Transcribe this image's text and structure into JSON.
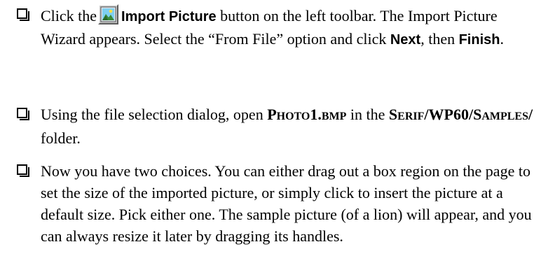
{
  "steps": [
    {
      "p1": "Click the",
      "button_label": "Import Picture",
      "p2": " button on the left toolbar. The Import Picture Wizard appears. Select the “From File” option and click ",
      "next_label": "Next",
      "p3": ", then ",
      "finish_label": "Finish",
      "p4": "."
    },
    {
      "p1": "Using the file selection dialog, open ",
      "file_first": "P",
      "file_rest": "HOTO",
      "file_num": "1.",
      "file_ext": "BMP",
      "p2": " in the ",
      "folder_s": "S",
      "folder_rest": "ERIF",
      "folder_mid": "/WP60/",
      "folder_s2": "S",
      "folder_rest2": "AMPLES",
      "folder_end": "/",
      "p3": " folder."
    },
    {
      "text": "Now you have two choices. You can either drag out a box region on the page to set the size of the imported picture, or simply click to insert the picture at a default size. Pick either one. The sample picture (of a lion) will appear, and you can always resize it later by dragging its handles."
    }
  ],
  "icons": {
    "toolbar_button": "import-picture-icon",
    "bullet": "checkbox-bullet-icon"
  }
}
